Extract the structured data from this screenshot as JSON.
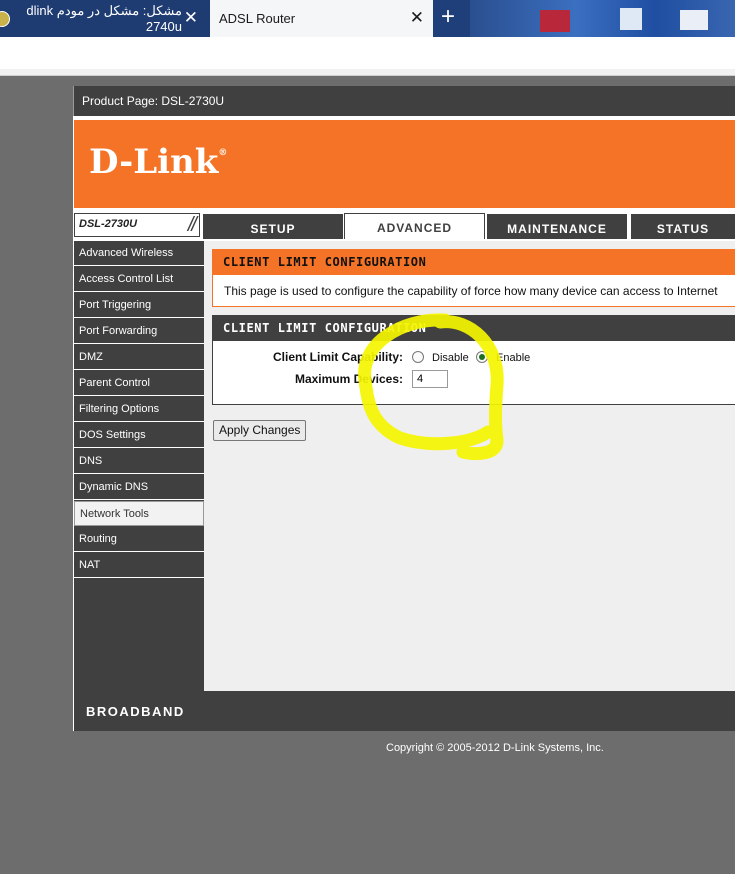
{
  "browser": {
    "tabs": [
      {
        "label": "مشکل: مشکل در مودم dlink 2740u",
        "active": false
      },
      {
        "label": "ADSL Router",
        "active": true
      }
    ],
    "close_glyph": "✕",
    "new_tab_glyph": "+"
  },
  "router": {
    "product_page": "Product Page: DSL-2730U",
    "logo": "D-Link",
    "logo_mark": "®",
    "model": "DSL-2730U",
    "nav_tabs": [
      "SETUP",
      "ADVANCED",
      "MAINTENANCE",
      "STATUS"
    ],
    "active_nav": "ADVANCED",
    "sidebar": [
      "Advanced Wireless",
      "Access Control List",
      "Port Triggering",
      "Port Forwarding",
      "DMZ",
      "Parent Control",
      "Filtering Options",
      "DOS Settings",
      "DNS",
      "Dynamic DNS",
      "Network Tools",
      "Routing",
      "NAT"
    ],
    "active_sidebar": "Network Tools",
    "section1": {
      "title": "CLIENT LIMIT CONFIGURATION",
      "description": "This page is used to configure the capability of force how many device can access to Internet"
    },
    "section2": {
      "title": "CLIENT LIMIT CONFIGURATION",
      "capability_label": "Client Limit Capability:",
      "option_disable": "Disable",
      "option_enable": "Enable",
      "selected": "Enable",
      "max_devices_label": "Maximum Devices:",
      "max_devices_value": "4"
    },
    "apply_button": "Apply Changes",
    "footer": "BROADBAND",
    "copyright": "Copyright © 2005-2012 D-Link Systems, Inc."
  },
  "colors": {
    "brand_orange": "#f47326",
    "dark_gray": "#404040",
    "highlight_yellow": "#f5f500"
  }
}
